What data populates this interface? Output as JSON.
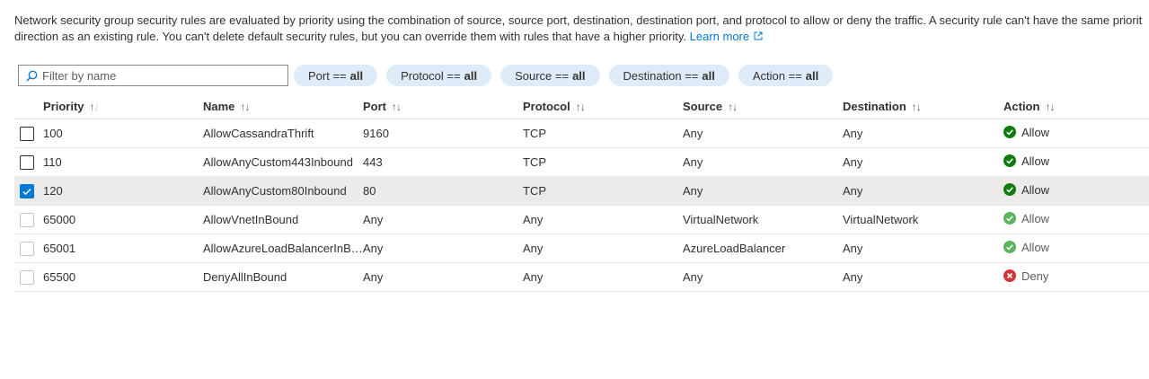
{
  "description": {
    "text": "Network security group security rules are evaluated by priority using the combination of source, source port, destination, destination port, and protocol to allow or deny the traffic. A security rule can't have the same priority and direction as an existing rule. You can't delete default security rules, but you can override them with rules that have a higher priority.",
    "line1": "Network security group security rules are evaluated by priority using the combination of source, source port, destination, destination port, and protocol to allow or deny the traffic. A security rule can't have the same priorit",
    "line2": "direction as an existing rule. You can't delete default security rules, but you can override them with rules that have a higher priority.",
    "learn_more": "Learn more"
  },
  "filters": {
    "search_placeholder": "Filter by name",
    "pills": [
      {
        "label": "Port ==",
        "value": "all"
      },
      {
        "label": "Protocol ==",
        "value": "all"
      },
      {
        "label": "Source ==",
        "value": "all"
      },
      {
        "label": "Destination ==",
        "value": "all"
      },
      {
        "label": "Action ==",
        "value": "all"
      }
    ]
  },
  "table": {
    "columns": [
      "Priority",
      "Name",
      "Port",
      "Protocol",
      "Source",
      "Destination",
      "Action"
    ],
    "rows": [
      {
        "priority": "100",
        "name": "AllowCassandraThrift",
        "port": "9160",
        "protocol": "TCP",
        "source": "Any",
        "destination": "Any",
        "action": "Allow",
        "checked": false,
        "custom": true
      },
      {
        "priority": "110",
        "name": "AllowAnyCustom443Inbound",
        "port": "443",
        "protocol": "TCP",
        "source": "Any",
        "destination": "Any",
        "action": "Allow",
        "checked": false,
        "custom": true
      },
      {
        "priority": "120",
        "name": "AllowAnyCustom80Inbound",
        "port": "80",
        "protocol": "TCP",
        "source": "Any",
        "destination": "Any",
        "action": "Allow",
        "checked": true,
        "custom": true
      },
      {
        "priority": "65000",
        "name": "AllowVnetInBound",
        "port": "Any",
        "protocol": "Any",
        "source": "VirtualNetwork",
        "destination": "VirtualNetwork",
        "action": "Allow",
        "checked": false,
        "custom": false
      },
      {
        "priority": "65001",
        "name": "AllowAzureLoadBalancerInB…",
        "port": "Any",
        "protocol": "Any",
        "source": "AzureLoadBalancer",
        "destination": "Any",
        "action": "Allow",
        "checked": false,
        "custom": false
      },
      {
        "priority": "65500",
        "name": "DenyAllInBound",
        "port": "Any",
        "protocol": "Any",
        "source": "Any",
        "destination": "Any",
        "action": "Deny",
        "checked": false,
        "custom": false
      }
    ]
  },
  "colors": {
    "allow": "#107c10",
    "deny": "#d13438",
    "accent": "#0078d4",
    "pill": "#deecf9"
  },
  "icons": {
    "search": "search-icon",
    "external": "external-link-icon",
    "allow": "check-circle-icon",
    "deny": "error-circle-icon"
  }
}
